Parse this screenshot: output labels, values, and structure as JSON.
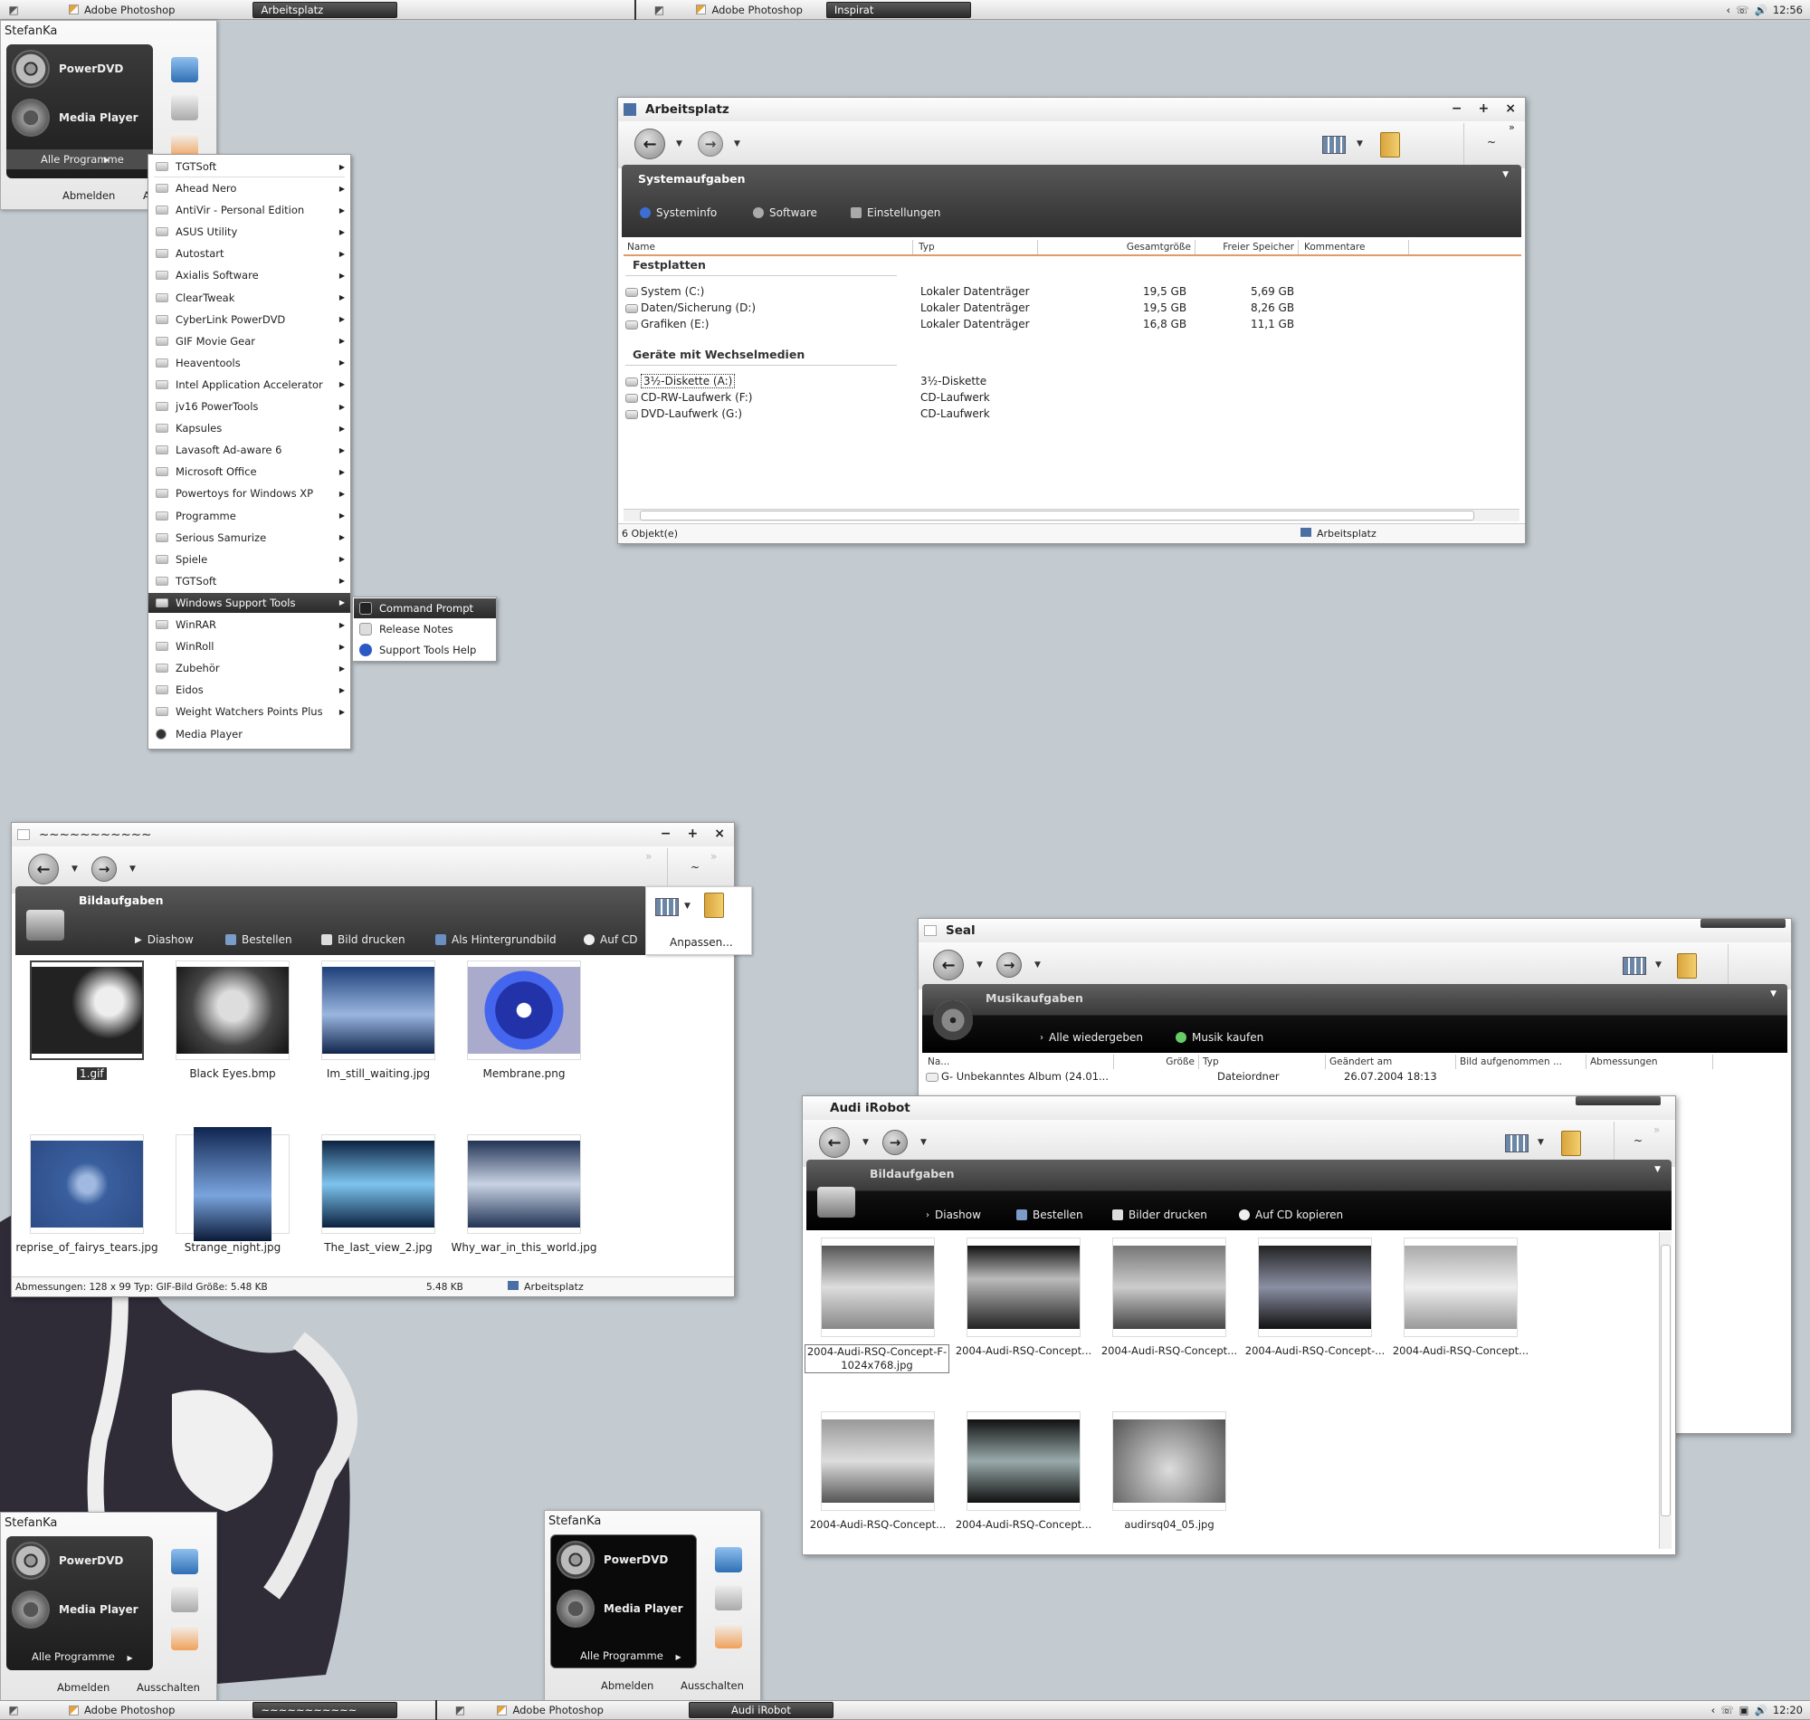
{
  "taskbar_top": {
    "app1": "Adobe Photoshop",
    "app1_active": "Arbeitsplatz",
    "app2": "Adobe Photoshop",
    "app2_active": "Inspirat",
    "time": "12:56"
  },
  "taskbar_bottom": {
    "app1": "Adobe Photoshop",
    "app1_active": "~~~~~~~~~~~",
    "app2": "Adobe Photoshop",
    "app2_active": "Audi iRobot",
    "time": "12:20"
  },
  "startmenu": {
    "user": "StefanKa",
    "prog1": "PowerDVD",
    "prog2": "Media Player",
    "all": "Alle Programme",
    "logoff": "Abmelden",
    "shutdown": "Ausschalten",
    "shutdown_partial": "A"
  },
  "programs": [
    "TGTSoft",
    "Ahead Nero",
    "AntiVir - Personal Edition",
    "ASUS Utility",
    "Autostart",
    "Axialis Software",
    "ClearTweak",
    "CyberLink PowerDVD",
    "GIF Movie Gear",
    "Heaventools",
    "Intel Application Accelerator",
    "jv16 PowerTools",
    "Kapsules",
    "Lavasoft Ad-aware 6",
    "Microsoft Office",
    "Powertoys for Windows XP",
    "Programme",
    "Serious Samurize",
    "Spiele",
    "TGTSoft",
    "Windows Support Tools",
    "WinRAR",
    "WinRoll",
    "Zubehör",
    "Eidos",
    "Weight Watchers Points Plus",
    "Media Player"
  ],
  "submenu": [
    "Command Prompt",
    "Release Notes",
    "Support Tools Help"
  ],
  "arbeitsplatz": {
    "title": "Arbeitsplatz",
    "pane_title": "Systemaufgaben",
    "links": [
      "Systeminfo",
      "Software",
      "Einstellungen"
    ],
    "columns": [
      "Name",
      "Typ",
      "Gesamtgröße",
      "Freier Speicher",
      "Kommentare"
    ],
    "group1": "Festplatten",
    "group2": "Geräte mit Wechselmedien",
    "drives": [
      {
        "name": "System (C:)",
        "type": "Lokaler Datenträger",
        "total": "19,5 GB",
        "free": "5,69 GB"
      },
      {
        "name": "Daten/Sicherung (D:)",
        "type": "Lokaler Datenträger",
        "total": "19,5 GB",
        "free": "8,26 GB"
      },
      {
        "name": "Grafiken (E:)",
        "type": "Lokaler Datenträger",
        "total": "16,8 GB",
        "free": "11,1 GB"
      }
    ],
    "removable": [
      {
        "name": "3½-Diskette (A:)",
        "type": "3½-Diskette"
      },
      {
        "name": "CD-RW-Laufwerk (F:)",
        "type": "CD-Laufwerk"
      },
      {
        "name": "DVD-Laufwerk (G:)",
        "type": "CD-Laufwerk"
      }
    ],
    "status_left": "6 Objekt(e)",
    "status_right": "Arbeitsplatz",
    "tilde": "~"
  },
  "pictures": {
    "title": "~~~~~~~~~~~",
    "pane_title": "Bildaufgaben",
    "links": [
      "Diashow",
      "Bestellen",
      "Bild drucken",
      "Als Hintergrundbild",
      "Auf CD"
    ],
    "customize": "Anpassen...",
    "tilde": "~",
    "files": [
      "1.gif",
      "Black Eyes.bmp",
      "Im_still_waiting.jpg",
      "Membrane.png",
      "reprise_of_fairys_tears.jpg",
      "Strange_night.jpg",
      "The_last_view_2.jpg",
      "Why_war_in_this_world.jpg"
    ],
    "status_left": "Abmessungen: 128 x 99 Typ: GIF-Bild Größe: 5.48 KB",
    "status_mid": "5.48 KB",
    "status_right": "Arbeitsplatz"
  },
  "seal": {
    "title": "Seal",
    "pane_title": "Musikaufgaben",
    "links": [
      "Alle wiedergeben",
      "Musik kaufen"
    ],
    "columns": [
      "Na...",
      "Größe",
      "Typ",
      "Geändert am",
      "Bild aufgenommen ...",
      "Abmessungen"
    ],
    "row": {
      "name": "G- Unbekanntes Album (24.01...",
      "type": "Dateiordner",
      "date": "26.07.2004 18:13"
    }
  },
  "audi": {
    "title": "Audi iRobot",
    "pane_title": "Bildaufgaben",
    "links": [
      "Diashow",
      "Bestellen",
      "Bilder drucken",
      "Auf CD kopieren"
    ],
    "tilde": "~",
    "files": [
      "2004-Audi-RSQ-Concept-F-1024x768.jpg",
      "2004-Audi-RSQ-Concept...",
      "2004-Audi-RSQ-Concept...",
      "2004-Audi-RSQ-Concept-...",
      "2004-Audi-RSQ-Concept...",
      "2004-Audi-RSQ-Concept...",
      "2004-Audi-RSQ-Concept...",
      "audirsq04_05.jpg"
    ]
  }
}
